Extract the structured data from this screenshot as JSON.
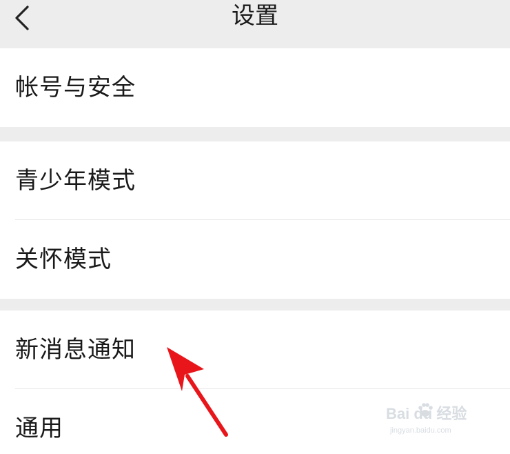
{
  "header": {
    "title": "设置",
    "back_icon": "chevron-left-icon"
  },
  "groups": [
    {
      "items": [
        {
          "label": "帐号与安全"
        }
      ]
    },
    {
      "items": [
        {
          "label": "青少年模式"
        },
        {
          "label": "关怀模式"
        }
      ]
    },
    {
      "items": [
        {
          "label": "新消息通知"
        },
        {
          "label": "通用"
        }
      ]
    }
  ],
  "annotation": {
    "arrow_color": "#e8161b"
  },
  "watermark": {
    "brand": "Bai  du 经验",
    "url": "jingyan.baidu.com"
  }
}
